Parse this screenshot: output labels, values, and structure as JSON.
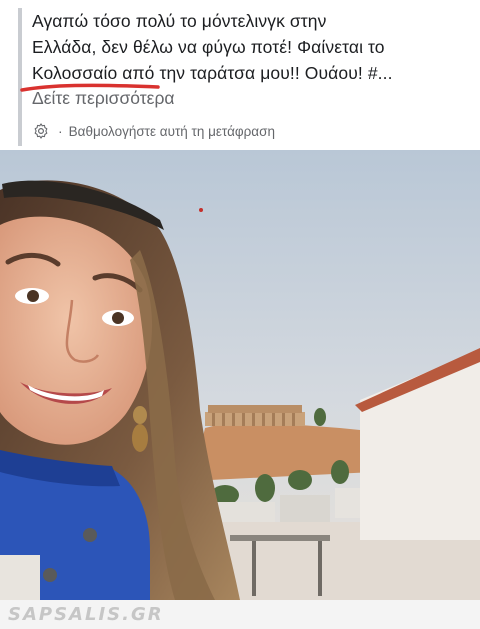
{
  "post": {
    "lines": [
      "Αγαπώ τόσο πολύ το μόντελινγκ στην",
      "Ελλάδα, δεν θέλω να φύγω ποτέ! Φαίνεται το",
      "Κολοσσαίο από την ταράτσα μου!! Ουάου! #..."
    ],
    "see_more": "Δείτε περισσότερα",
    "underline_color": "#d9322f"
  },
  "translation": {
    "separator": "·",
    "label": "Βαθμολογήστε αυτή τη μετάφραση",
    "icon": "gear-icon"
  },
  "photo": {
    "description_icon": "selfie-photo"
  },
  "watermark": {
    "text": "SAPSALIS.GR"
  }
}
